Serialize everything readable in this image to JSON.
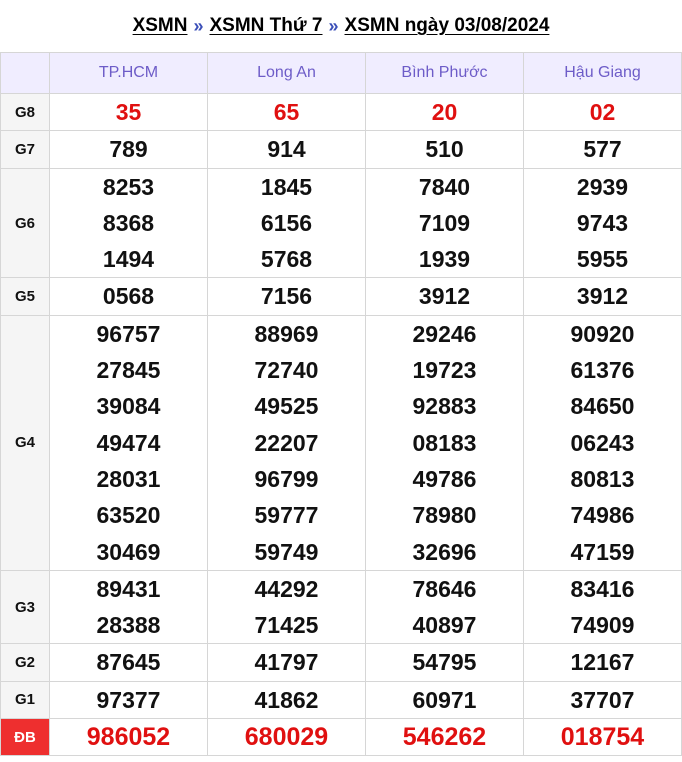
{
  "breadcrumb": {
    "items": [
      "XSMN",
      "XSMN Thứ 7",
      "XSMN ngày 03/08/2024"
    ],
    "separator": "»"
  },
  "provinces": [
    "TP.HCM",
    "Long An",
    "Bình Phước",
    "Hậu Giang"
  ],
  "prizes": [
    {
      "label": "G8",
      "highlight": true,
      "values": [
        [
          "35"
        ],
        [
          "65"
        ],
        [
          "20"
        ],
        [
          "02"
        ]
      ]
    },
    {
      "label": "G7",
      "values": [
        [
          "789"
        ],
        [
          "914"
        ],
        [
          "510"
        ],
        [
          "577"
        ]
      ]
    },
    {
      "label": "G6",
      "values": [
        [
          "8253",
          "8368",
          "1494"
        ],
        [
          "1845",
          "6156",
          "5768"
        ],
        [
          "7840",
          "7109",
          "1939"
        ],
        [
          "2939",
          "9743",
          "5955"
        ]
      ]
    },
    {
      "label": "G5",
      "values": [
        [
          "0568"
        ],
        [
          "7156"
        ],
        [
          "3912"
        ],
        [
          "3912"
        ]
      ]
    },
    {
      "label": "G4",
      "values": [
        [
          "96757",
          "27845",
          "39084",
          "49474",
          "28031",
          "63520",
          "30469"
        ],
        [
          "88969",
          "72740",
          "49525",
          "22207",
          "96799",
          "59777",
          "59749"
        ],
        [
          "29246",
          "19723",
          "92883",
          "08183",
          "49786",
          "78980",
          "32696"
        ],
        [
          "90920",
          "61376",
          "84650",
          "06243",
          "80813",
          "74986",
          "47159"
        ]
      ]
    },
    {
      "label": "G3",
      "values": [
        [
          "89431",
          "28388"
        ],
        [
          "44292",
          "71425"
        ],
        [
          "78646",
          "40897"
        ],
        [
          "83416",
          "74909"
        ]
      ]
    },
    {
      "label": "G2",
      "values": [
        [
          "87645"
        ],
        [
          "41797"
        ],
        [
          "54795"
        ],
        [
          "12167"
        ]
      ]
    },
    {
      "label": "G1",
      "values": [
        [
          "97377"
        ],
        [
          "41862"
        ],
        [
          "60971"
        ],
        [
          "37707"
        ]
      ]
    },
    {
      "label": "ĐB",
      "highlight": true,
      "special": true,
      "values": [
        [
          "986052"
        ],
        [
          "680029"
        ],
        [
          "546262"
        ],
        [
          "018754"
        ]
      ]
    }
  ],
  "colors": {
    "header_bg": "#f0edff",
    "header_text": "#6d5cc8",
    "highlight_text": "#e01010",
    "special_label_bg": "#ee2f2f",
    "label_bg": "#f5f5f5"
  }
}
